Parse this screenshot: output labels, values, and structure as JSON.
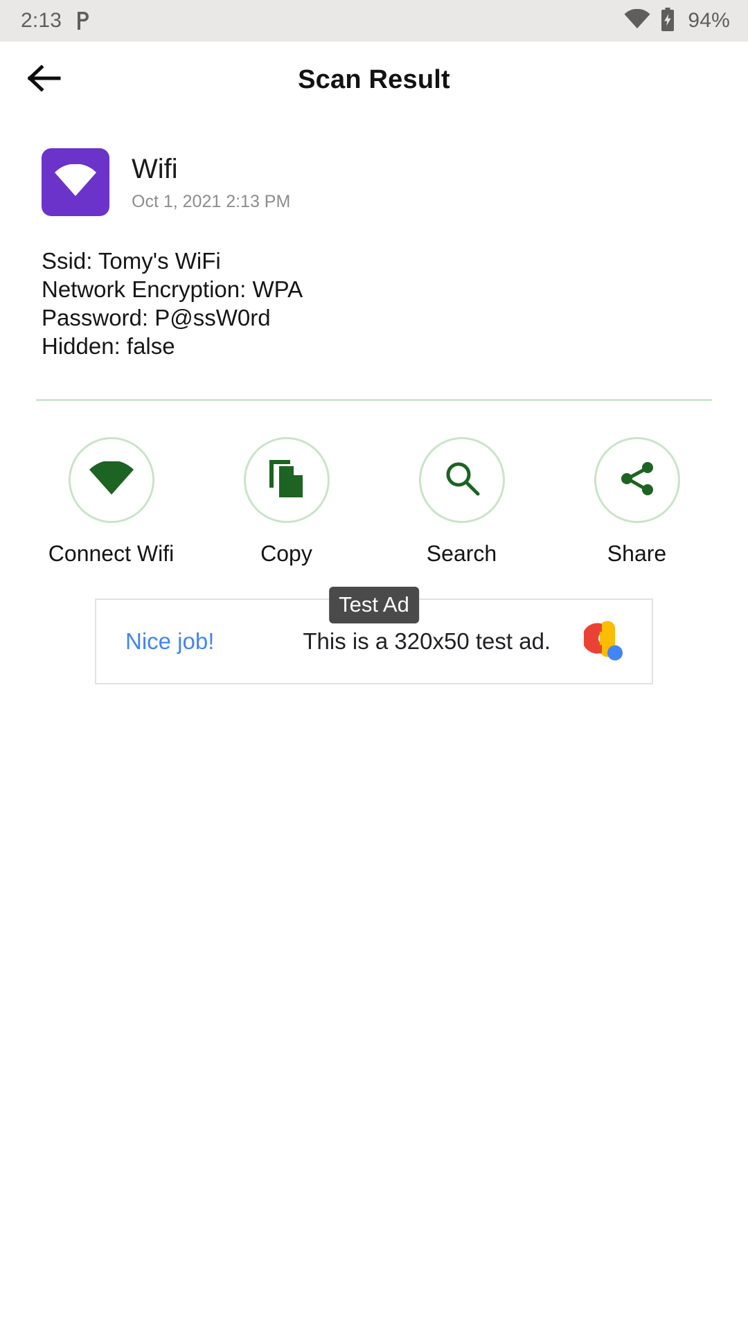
{
  "status_bar": {
    "time": "2:13",
    "notification_icon": "pushbullet-p-icon",
    "wifi_icon": "wifi-icon",
    "battery_icon": "battery-charging-icon",
    "battery_percent": "94%",
    "background_color": "#eae8e6"
  },
  "app_bar": {
    "back_icon": "arrow-left-icon",
    "title": "Scan Result"
  },
  "result": {
    "tile_icon": "wifi-icon",
    "tile_color": "#6b33c9",
    "type": "Wifi",
    "date": "Oct 1, 2021 2:13 PM",
    "details": [
      "Ssid: Tomy's WiFi",
      "Network Encryption: WPA",
      "Password: P@ssW0rd",
      "Hidden: false"
    ]
  },
  "divider_color": "#cfe5cf",
  "accent_color": "#1d6322",
  "actions": [
    {
      "label": "Connect Wifi",
      "icon": "wifi-icon"
    },
    {
      "label": "Copy",
      "icon": "copy-icon"
    },
    {
      "label": "Search",
      "icon": "search-icon"
    },
    {
      "label": "Share",
      "icon": "share-icon"
    }
  ],
  "ad": {
    "badge": "Test Ad",
    "cta": "Nice job!",
    "body": "This is a 320x50 test ad.",
    "logo_icon": "admob-logo-icon"
  }
}
